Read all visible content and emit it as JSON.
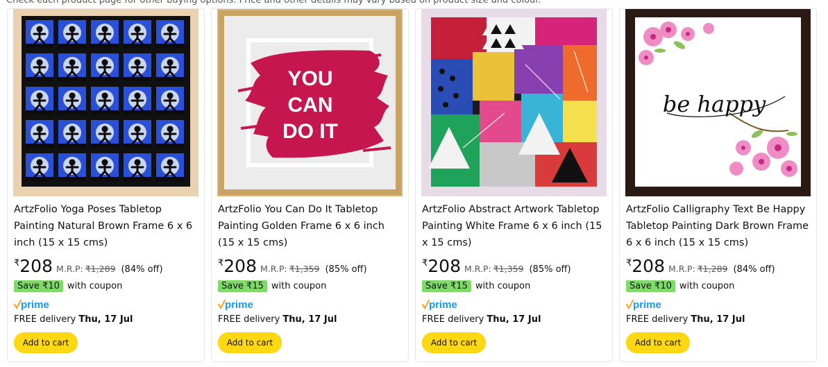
{
  "notice": "Check each product page for other buying options. Price and other details may vary based on product size and colour.",
  "currency_symbol": "₹",
  "products": [
    {
      "title": "ArtzFolio Yoga Poses Tabletop Painting Natural Brown Frame 6 x 6 inch (15 x 15 cms)",
      "price": "208",
      "mrp_label": "M.R.P:",
      "mrp": "₹1,289",
      "discount": "(84% off)",
      "save_badge": "Save ₹10",
      "coupon_text": "with coupon",
      "prime_label": "prime",
      "delivery_prefix": "FREE delivery",
      "delivery_date": "Thu, 17 Jul",
      "add_to_cart": "Add to cart",
      "frame_color": "#ead2b1"
    },
    {
      "title": "ArtzFolio You Can Do It Tabletop Painting Golden Frame 6 x 6 inch (15 x 15 cms)",
      "price": "208",
      "mrp_label": "M.R.P:",
      "mrp": "₹1,359",
      "discount": "(85% off)",
      "save_badge": "Save ₹15",
      "coupon_text": "with coupon",
      "prime_label": "prime",
      "delivery_prefix": "FREE delivery",
      "delivery_date": "Thu, 17 Jul",
      "add_to_cart": "Add to cart",
      "frame_color": "#d9b577",
      "art_text": [
        "YOU",
        "CAN",
        "DO IT"
      ]
    },
    {
      "title": "ArtzFolio Abstract Artwork Tabletop Painting White Frame 6 x 6 inch (15 x 15 cms)",
      "price": "208",
      "mrp_label": "M.R.P:",
      "mrp": "₹1,359",
      "discount": "(85% off)",
      "save_badge": "Save ₹15",
      "coupon_text": "with coupon",
      "prime_label": "prime",
      "delivery_prefix": "FREE delivery",
      "delivery_date": "Thu, 17 Jul",
      "add_to_cart": "Add to cart",
      "frame_color": "#e6dbe6"
    },
    {
      "title": "ArtzFolio Calligraphy Text Be Happy Tabletop Painting Dark Brown Frame 6 x 6 inch (15 x 15 cms)",
      "price": "208",
      "mrp_label": "M.R.P:",
      "mrp": "₹1,289",
      "discount": "(84% off)",
      "save_badge": "Save ₹10",
      "coupon_text": "with coupon",
      "prime_label": "prime",
      "delivery_prefix": "FREE delivery",
      "delivery_date": "Thu, 17 Jul",
      "add_to_cart": "Add to cart",
      "frame_color": "#2b1a14",
      "art_text": [
        "be happy"
      ]
    }
  ],
  "colors": {
    "add_to_cart_bg": "#ffd814",
    "save_badge_bg": "#7fda69",
    "prime_blue": "#1399ff",
    "prime_check": "#f7a82d"
  }
}
